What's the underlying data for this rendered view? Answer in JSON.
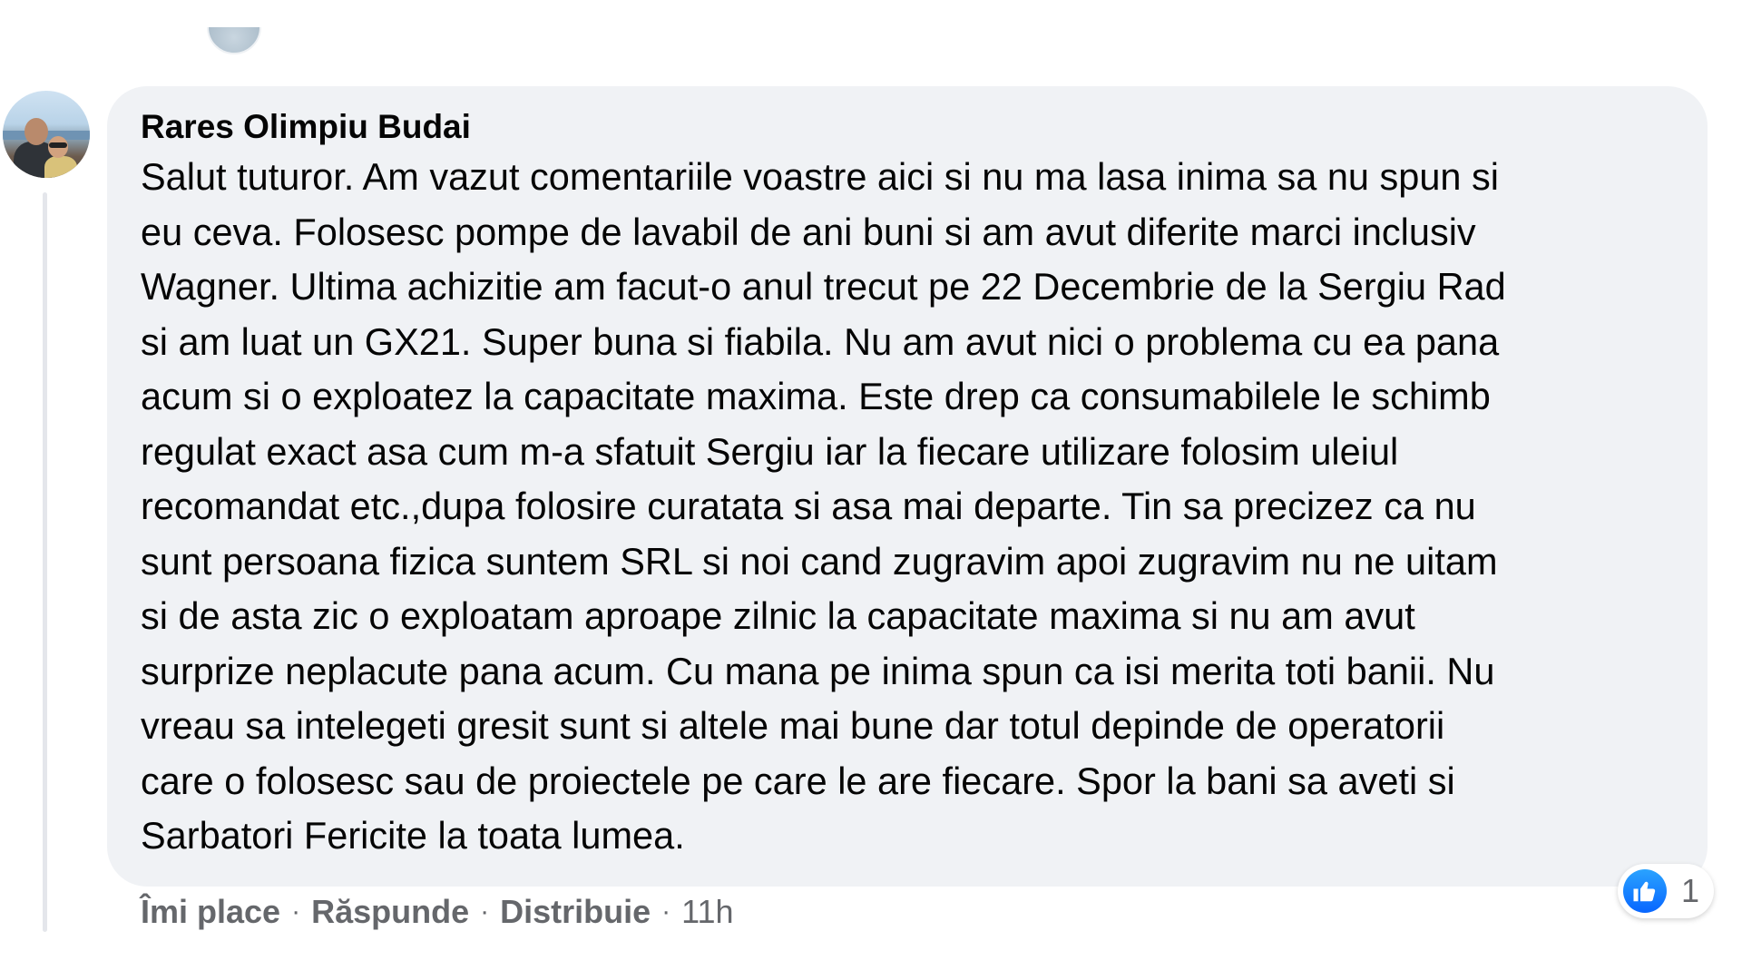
{
  "comment": {
    "author": "Rares Olimpiu Budai",
    "text_lines": [
      "Salut tuturor. Am vazut comentariile voastre aici si nu ma lasa inima sa nu spun si",
      "eu ceva. Folosesc pompe de lavabil de ani buni si am avut diferite marci inclusiv",
      "Wagner. Ultima achizitie am facut-o anul trecut pe 22 Decembrie de la Sergiu Rad",
      "si am luat un GX21. Super buna si fiabila. Nu am avut nici o problema cu ea pana",
      "acum si o exploatez la capacitate maxima. Este drep ca consumabilele le schimb",
      "regulat exact asa cum m-a sfatuit Sergiu iar la fiecare utilizare folosim uleiul",
      "recomandat etc.,dupa folosire curatata si asa mai departe. Tin sa precizez ca nu",
      "sunt persoana fizica suntem SRL si noi cand zugravim apoi zugravim nu ne uitam",
      "si de asta zic o exploatam aproape zilnic la capacitate maxima si nu am avut",
      "surprize neplacute pana acum. Cu mana pe inima spun ca isi merita toti banii. Nu",
      "vreau sa intelegeti gresit sunt si altele mai bune dar totul depinde de operatorii",
      "care o folosesc sau de proiectele pe care le are fiecare. Spor la bani sa aveti si",
      "Sarbatori Fericite la toata lumea."
    ]
  },
  "actions": {
    "like_label": "Îmi place",
    "reply_label": "Răspunde",
    "share_label": "Distribuie",
    "separator": "·",
    "timestamp": "11h"
  },
  "reactions": {
    "icon": "thumbs-up-icon",
    "count": "1",
    "accent_color": "#0866ff"
  },
  "colors": {
    "bubble_bg": "#f0f2f5",
    "text": "#050505",
    "secondary_text": "#65676b"
  }
}
